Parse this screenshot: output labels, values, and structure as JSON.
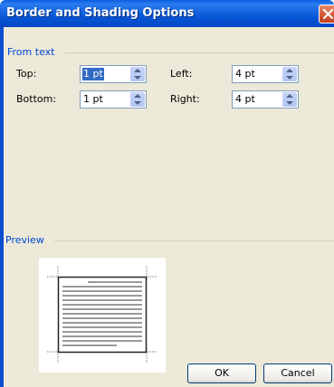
{
  "window": {
    "title": "Border and Shading Options"
  },
  "groups": {
    "from_text": "From text",
    "preview": "Preview"
  },
  "fields": {
    "top_label": "Top:",
    "top_value": "1 pt",
    "bottom_label": "Bottom:",
    "bottom_value": "1 pt",
    "left_label": "Left:",
    "left_value": "4 pt",
    "right_label": "Right:",
    "right_value": "4 pt"
  },
  "buttons": {
    "ok": "OK",
    "cancel": "Cancel"
  },
  "icons": {
    "close": "close-icon",
    "spin": "spin-arrows-icon"
  },
  "colors": {
    "titlebar": "#0858d8",
    "group_label": "#0046d5",
    "dialog_bg": "#ece9d8",
    "selection": "#316ac5"
  }
}
